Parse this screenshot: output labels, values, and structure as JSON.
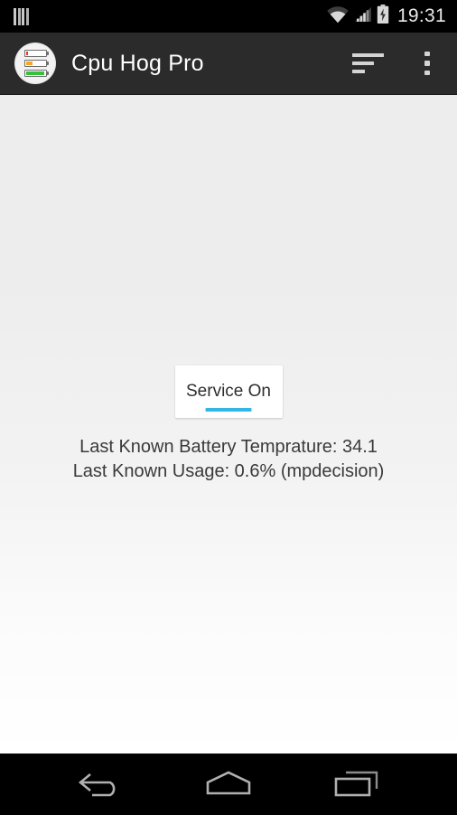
{
  "status_bar": {
    "notification_icon": "equalizer-bars-icon",
    "wifi_icon": "wifi-icon",
    "signal_icon": "cellular-signal-icon",
    "battery_icon": "battery-charging-icon",
    "time": "19:31"
  },
  "action_bar": {
    "app_icon": "cpu-hog-battery-icon",
    "title": "Cpu Hog Pro",
    "sort_icon": "sort-lines-icon",
    "overflow_icon": "overflow-menu-icon"
  },
  "main": {
    "service_card": {
      "label": "Service On",
      "indicator_color": "#33b5e5"
    },
    "info": [
      "Last Known Battery Temprature: 34.1",
      "Last Known Usage: 0.6% (mpdecision)"
    ]
  },
  "nav_bar": {
    "back": "back-icon",
    "home": "home-icon",
    "recents": "recent-apps-icon"
  },
  "colors": {
    "status_bar_bg": "#000000",
    "action_bar_bg": "#2b2b2b",
    "content_bg_top": "#ededed",
    "content_bg_bottom": "#ffffff",
    "accent": "#33b5e5",
    "title_text": "#ffffff",
    "body_text": "#3a3a3a"
  }
}
